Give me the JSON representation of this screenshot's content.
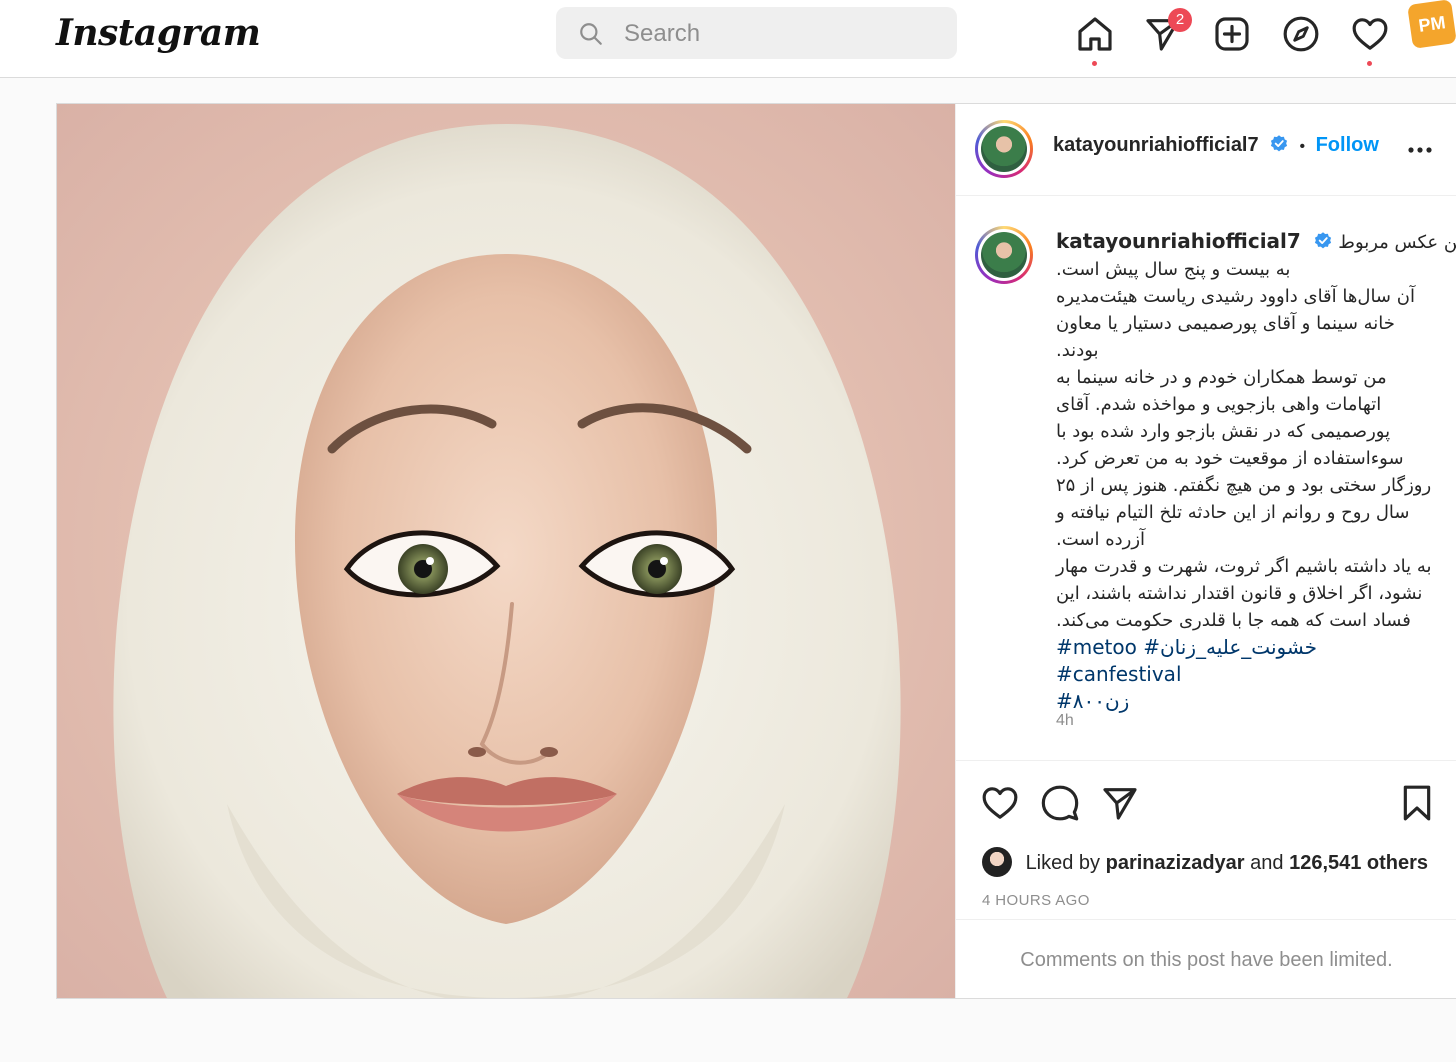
{
  "header": {
    "logo": "Instagram",
    "search": {
      "placeholder": "Search",
      "value": ""
    },
    "icons": [
      "home-icon",
      "direct-messages-icon",
      "new-post-icon",
      "explore-icon",
      "activity-heart-icon"
    ],
    "messages_badge": "2",
    "watermark": "PM"
  },
  "post": {
    "image_icon": "portrait-photo",
    "author": {
      "username": "katayounriahiofficial7",
      "verified": true,
      "separator": "•",
      "follow_label": "Follow",
      "more_label": "..."
    },
    "caption": {
      "username": "katayounriahiofficial7",
      "lines": [
        "این عکس مربوط",
        ".به بیست و پنج سال پیش است",
        "آن سال‌ها آقای داوود رشیدی ریاست هیئت‌مدیره",
        "خانه سینما و آقای پورصمیمی دستیار یا معاون",
        ".بودند",
        "من توسط همکاران خودم و در خانه سینما به",
        "اتهامات واهی بازجویی و مواخذه شدم. آقای",
        "پورصمیمی که در نقش بازجو وارد شده بود با",
        ".سوءاستفاده از موقعیت خود به من تعرض کرد",
        "روزگار سختی بود و من هیچ نگفتم. هنوز پس از ۲۵",
        "سال روح و روانم از این حادثه تلخ التیام نیافته و",
        ".آزرده است",
        "به یاد داشته باشیم اگر ثروت، شهرت و قدرت مهار",
        "نشود، اگر اخلاق و قانون اقتدار نداشته باشند، این",
        ".فساد است که همه جا با قلدری حکومت می‌کند"
      ],
      "hashtags_line1": "#metoo #خشونت_علیه_زنان #canfestival",
      "hashtags_line2": "#۸۰۰زن",
      "time": "4h"
    },
    "actions": [
      "like-heart-icon",
      "comment-icon",
      "share-icon",
      "save-bookmark-icon"
    ],
    "likes": {
      "prefix": "Liked by",
      "liked_by_user": "parinazizadyar",
      "and": "and",
      "others": "126,541 others"
    },
    "timestamp": "4 HOURS AGO",
    "comments_notice": "Comments on this post have been limited."
  },
  "colors": {
    "accent_blue": "#0095f6",
    "notification_red": "#ed4956",
    "hashtag_blue": "#00376b",
    "muted_gray": "#8e8e8e"
  }
}
